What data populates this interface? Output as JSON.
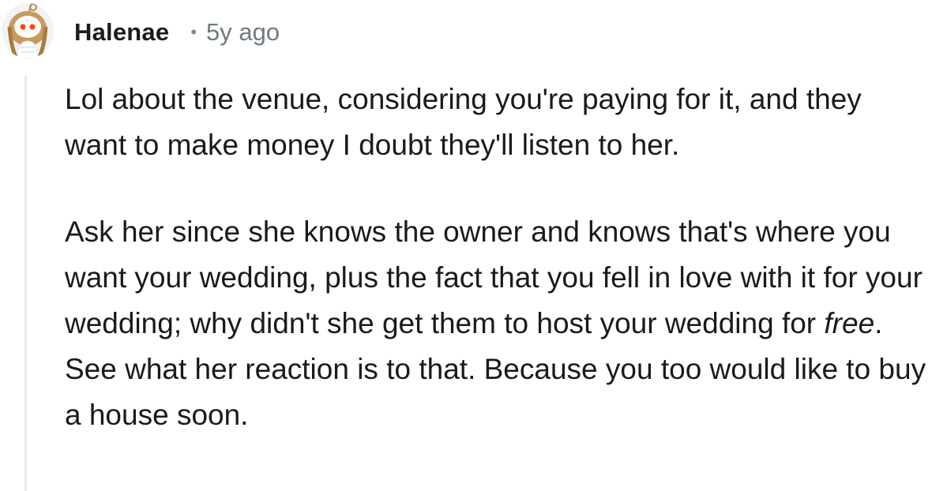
{
  "comment": {
    "author": "Halenae",
    "separator": "•",
    "timestamp": "5y ago",
    "avatar_icon": "snoo-avatar-icon",
    "paragraph1": "Lol about the venue, considering you're paying for it, and they want to make money I doubt they'll listen to her.",
    "paragraph2": {
      "before": "Ask her since she knows the owner and knows that's where you want your wedding, plus the fact that you fell in love with it for your wedding; why didn't she get them to host your wedding for ",
      "emphasis": "free",
      "after": ". See what her reaction is to that. Because you too would like to buy a house soon."
    }
  },
  "colors": {
    "text": "#1a1a1b",
    "meta": "#6f7a80",
    "thread_line": "#e8e9ea"
  }
}
